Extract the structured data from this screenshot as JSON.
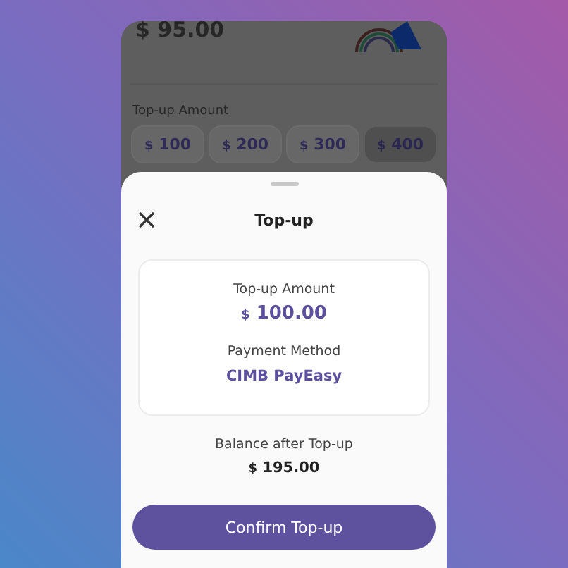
{
  "background": {
    "balance": {
      "currency": "$",
      "value": "95.00"
    },
    "amount_label": "Top-up Amount",
    "amounts": [
      {
        "currency": "$",
        "value": "100",
        "selected": false
      },
      {
        "currency": "$",
        "value": "200",
        "selected": false
      },
      {
        "currency": "$",
        "value": "300",
        "selected": false
      },
      {
        "currency": "$",
        "value": "400",
        "selected": true
      }
    ]
  },
  "sheet": {
    "title": "Top-up",
    "summary": {
      "amount_label": "Top-up Amount",
      "amount": {
        "currency": "$",
        "value": "100.00"
      },
      "method_label": "Payment Method",
      "method": "CIMB PayEasy"
    },
    "balance_label": "Balance after Top-up",
    "balance": {
      "currency": "$",
      "value": "195.00"
    },
    "confirm_button": "Confirm Top-up"
  }
}
